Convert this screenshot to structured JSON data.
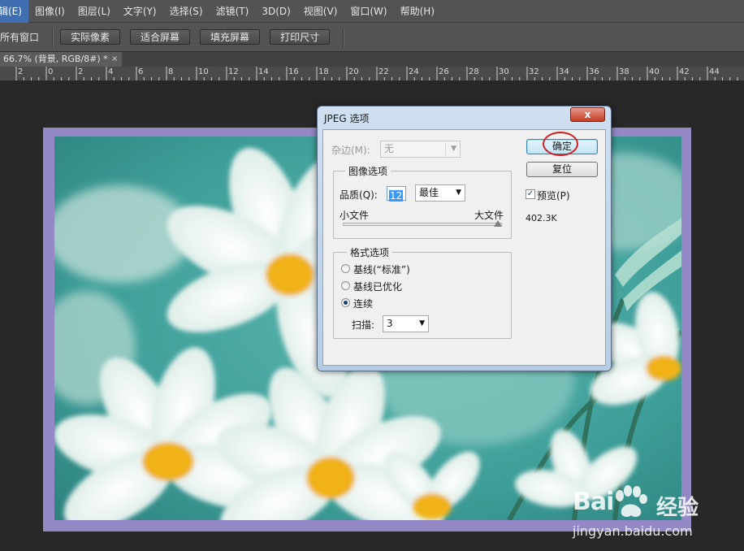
{
  "menubar": {
    "items": [
      "编辑(E)",
      "图像(I)",
      "图层(L)",
      "文字(Y)",
      "选择(S)",
      "滤镜(T)",
      "3D(D)",
      "视图(V)",
      "窗口(W)",
      "帮助(H)"
    ],
    "first_item_visible": "辑(E)"
  },
  "optionsbar": {
    "label": "所有窗口",
    "buttons": [
      "实际像素",
      "适合屏幕",
      "填充屏幕",
      "打印尺寸"
    ]
  },
  "document_tab": {
    "title": "66.7% (背景, RGB/8#) *",
    "close": "×"
  },
  "ruler": {
    "labels": [
      "2",
      "0",
      "2",
      "4",
      "6",
      "8",
      "10",
      "12",
      "14",
      "16",
      "18",
      "20",
      "22",
      "24",
      "26",
      "28",
      "30",
      "32",
      "34",
      "36",
      "38",
      "40",
      "42",
      "44"
    ]
  },
  "dialog": {
    "title": "JPEG 选项",
    "close_symbol": "x",
    "matte": {
      "label": "杂边(M):",
      "value": "无"
    },
    "image_options": {
      "title": "图像选项",
      "quality_label": "品质(Q):",
      "quality_value": "12",
      "quality_preset": "最佳",
      "small_file": "小文件",
      "large_file": "大文件",
      "quality_fraction": 1.0
    },
    "format_options": {
      "title": "格式选项",
      "radios": [
        {
          "label": "基线(“标准”)",
          "checked": false
        },
        {
          "label": "基线已优化",
          "checked": false
        },
        {
          "label": "连续",
          "checked": true
        }
      ],
      "scans_label": "扫描:",
      "scans_value": "3"
    },
    "ok_button": "确定",
    "reset_button": "复位",
    "preview_label": "预览(P)",
    "preview_checked": true,
    "file_size": "402.3K"
  },
  "watermark": {
    "brand_left": "Bai",
    "brand_right": "经验",
    "url": "jingyan.baidu.com"
  },
  "colors": {
    "ps_panel": "#535353",
    "canvas_bg": "#282828",
    "frame": "#9588c6",
    "photo_teal": "#3e9e99",
    "annotation": "#d02020"
  }
}
